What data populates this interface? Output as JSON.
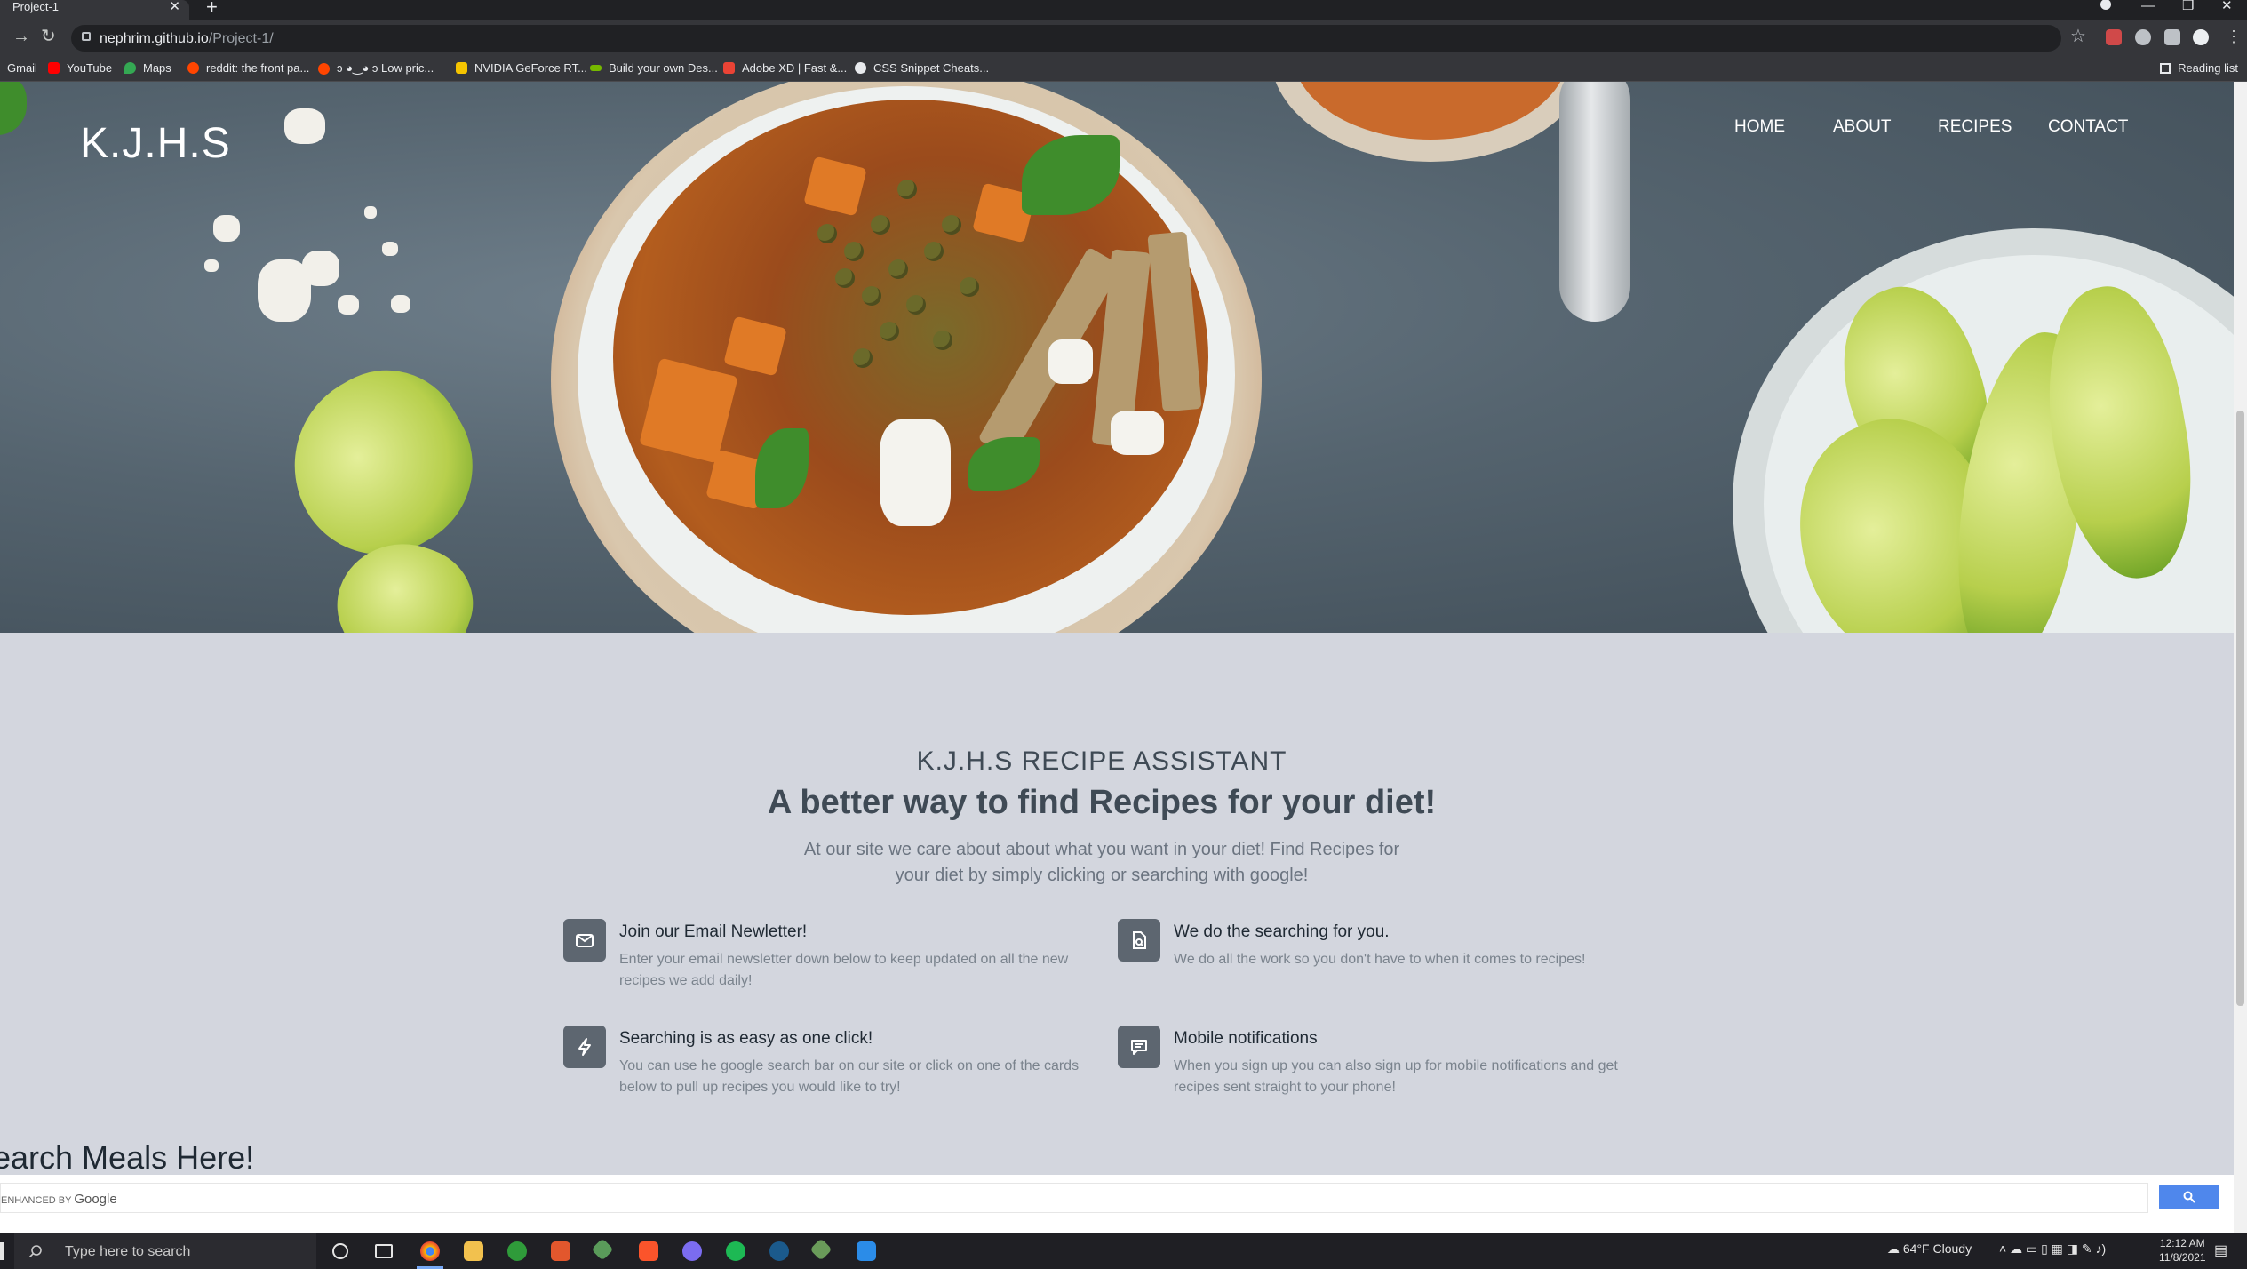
{
  "browser": {
    "tab_title": "Project-1",
    "tab_close": "✕",
    "new_tab": "+",
    "url_host": "nephrim.github.io",
    "url_path": "/Project-1/",
    "bookmarks": [
      "Gmail",
      "YouTube",
      "Maps",
      "reddit: the front pa...",
      "ɔ ◕‿◕ ɔ Low pric...",
      "NVIDIA GeForce RT...",
      "Build your own Des...",
      "Adobe XD | Fast &...",
      "CSS Snippet Cheats..."
    ],
    "reading_list": "Reading list",
    "window_controls": [
      "—",
      "❐",
      "✕"
    ]
  },
  "site": {
    "logo": "K.J.H.S",
    "nav": [
      "HOME",
      "ABOUT",
      "RECIPES",
      "CONTACT"
    ],
    "kicker": "K.J.H.S RECIPE ASSISTANT",
    "headline": "A better way to find Recipes for your diet!",
    "lede": "At our site we care about about what you want in your diet! Find Recipes for your diet by simply clicking or searching with google!",
    "features": [
      {
        "icon": "mail-icon",
        "title": "Join our Email Newletter!",
        "text": "Enter your email newsletter down below to keep updated on all the new recipes we add daily!"
      },
      {
        "icon": "document-search-icon",
        "title": "We do the searching for you.",
        "text": "We do all the work so you don't have to when it comes to recipes!"
      },
      {
        "icon": "lightning-icon",
        "title": "Searching is as easy as one click!",
        "text": "You can use he google search bar on our site or click on one of the cards below to pull up recipes you would like to try!"
      },
      {
        "icon": "chat-icon",
        "title": "Mobile notifications",
        "text": "When you sign up you can also sign up for mobile notifications and get recipes sent straight to your phone!"
      }
    ],
    "search_title": "earch Meals Here!",
    "powered_prefix": "ENHANCED BY",
    "powered_brand": "Google"
  },
  "taskbar": {
    "search_placeholder": "Type here to search",
    "weather": "64°F  Cloudy",
    "time": "12:12 AM",
    "date": "11/8/2021"
  }
}
